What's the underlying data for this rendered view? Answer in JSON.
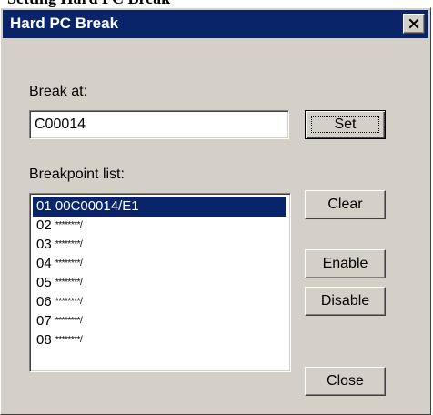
{
  "page": {
    "caption_fragment": "Setting Hard PC Break"
  },
  "dialog": {
    "title": "Hard PC Break",
    "close_symbol": "✕"
  },
  "break_at": {
    "label": "Break at:",
    "value": "C00014"
  },
  "buttons": {
    "set": "Set",
    "clear": "Clear",
    "enable": "Enable",
    "disable": "Disable",
    "close": "Close"
  },
  "breakpoints": {
    "label": "Breakpoint list:",
    "items": [
      {
        "number": "01",
        "address": "00C00014/E1",
        "selected": true
      },
      {
        "number": "02",
        "address": "********/",
        "selected": false
      },
      {
        "number": "03",
        "address": "********/",
        "selected": false
      },
      {
        "number": "04",
        "address": "********/",
        "selected": false
      },
      {
        "number": "05",
        "address": "********/",
        "selected": false
      },
      {
        "number": "06",
        "address": "********/",
        "selected": false
      },
      {
        "number": "07",
        "address": "********/",
        "selected": false
      },
      {
        "number": "08",
        "address": "********/",
        "selected": false
      }
    ]
  },
  "colors": {
    "window_background": "#d4d0c8",
    "titlebar_background": "#0a246a",
    "selection_background": "#0a246a",
    "field_background": "#ffffff"
  },
  "icons": {
    "close": "close-icon"
  }
}
